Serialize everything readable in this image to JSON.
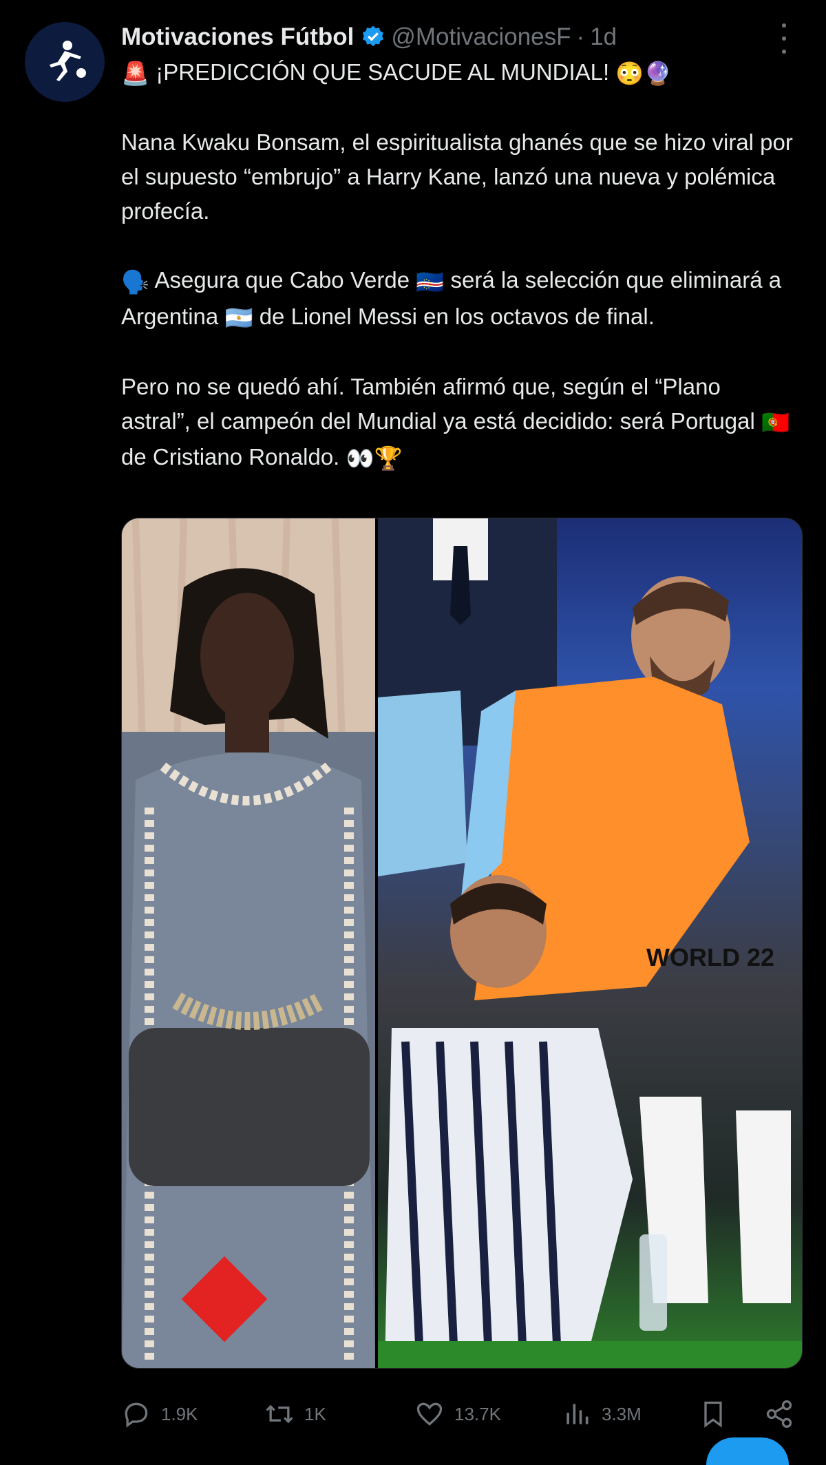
{
  "post": {
    "author_name": "Motivaciones Fútbol",
    "handle": "@MotivacionesF",
    "separator": "·",
    "time": "1d",
    "avatar_icon": "soccer-player-silhouette",
    "verified_icon": "verified-badge",
    "headline_prefix_emoji": "🚨",
    "headline": "¡PREDICCIÓN QUE SACUDE AL MUNDIAL!",
    "headline_suffix_emojis": "😳🔮",
    "paragraph_1": "Nana Kwaku Bonsam, el espiritualista ghanés que se hizo viral por el supuesto “embrujo” a Harry Kane, lanzó una nueva y polémica profecía.",
    "paragraph_2": {
      "lead_emoji": "🗣️",
      "part_a": "Asegura que Cabo Verde",
      "flag_a": "🇨🇻",
      "part_b": "será la selección que eliminará a Argentina",
      "flag_b": "🇦🇷",
      "part_c": "de Lionel Messi en los octavos de final."
    },
    "paragraph_3": {
      "part_a": "Pero no se quedó ahí. También afirmó que, según el “Plano astral”, el campeón del Mundial ya está decidido: será Portugal",
      "flag": "🇵🇹",
      "part_b": "de Cristiano Ronaldo.",
      "trail_emojis": "👀🏆"
    }
  },
  "media": {
    "left_photo": "spiritualist-portrait",
    "right_photo": "argentina-bench-photo",
    "jersey_text": "WORLD 22"
  },
  "actions": {
    "replies": "1.9K",
    "reposts": "1K",
    "likes": "13.7K",
    "views": "3.3M"
  },
  "colors": {
    "background": "#000000",
    "text": "#e7e9ea",
    "secondary": "#71767b",
    "accent": "#1d9bf0"
  }
}
